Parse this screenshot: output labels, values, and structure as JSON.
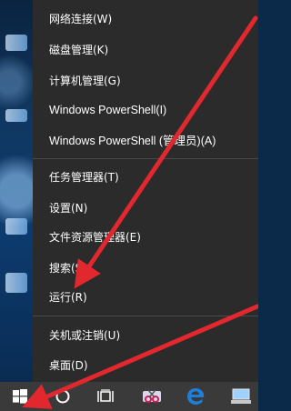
{
  "menu": {
    "items": [
      {
        "id": "network",
        "label": "网络连接(W)"
      },
      {
        "id": "disk",
        "label": "磁盘管理(K)"
      },
      {
        "id": "computer-management",
        "label": "计算机管理(G)"
      },
      {
        "id": "powershell",
        "label": "Windows PowerShell(I)"
      },
      {
        "id": "powershell-admin",
        "label": "Windows PowerShell (管理员)(A)"
      },
      {
        "id": "task-manager",
        "label": "任务管理器(T)"
      },
      {
        "id": "settings",
        "label": "设置(N)"
      },
      {
        "id": "file-explorer",
        "label": "文件资源管理器(E)"
      },
      {
        "id": "search",
        "label": "搜索(S)"
      },
      {
        "id": "run",
        "label": "运行(R)"
      },
      {
        "id": "shutdown",
        "label": "关机或注销(U)"
      },
      {
        "id": "desktop",
        "label": "桌面(D)"
      }
    ]
  },
  "taskbar": {
    "icons": [
      "windows-start-icon",
      "cortana-icon",
      "task-view-icon",
      "snipping-tool-icon",
      "edge-icon",
      "computer-icon"
    ]
  },
  "colors": {
    "menu_bg": "#2b2b2b",
    "taskbar_bg": "#3a3a3a",
    "arrow": "#e0282e",
    "edge_blue": "#1e7fd8"
  }
}
